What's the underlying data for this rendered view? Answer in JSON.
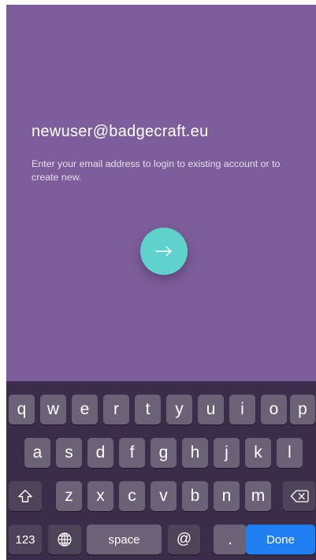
{
  "login": {
    "email_value": "newuser@badgecraft.eu",
    "hint_text": "Enter your email address to login to existing account or to create new.",
    "submit_icon": "arrow-right-icon"
  },
  "keyboard": {
    "row1": [
      "q",
      "w",
      "e",
      "r",
      "t",
      "y",
      "u",
      "i",
      "o",
      "p"
    ],
    "row2": [
      "a",
      "s",
      "d",
      "f",
      "g",
      "h",
      "j",
      "k",
      "l"
    ],
    "row3": [
      "z",
      "x",
      "c",
      "v",
      "b",
      "n",
      "m"
    ],
    "shift_icon": "shift-icon",
    "delete_icon": "backspace-icon",
    "numbers_label": "123",
    "globe_icon": "globe-icon",
    "space_label": "space",
    "at_label": "@",
    "dot_label": ".",
    "done_label": "Done"
  },
  "colors": {
    "background": "#7d5e9a",
    "accent": "#5fd2cb",
    "done_key": "#1f7ff2"
  }
}
